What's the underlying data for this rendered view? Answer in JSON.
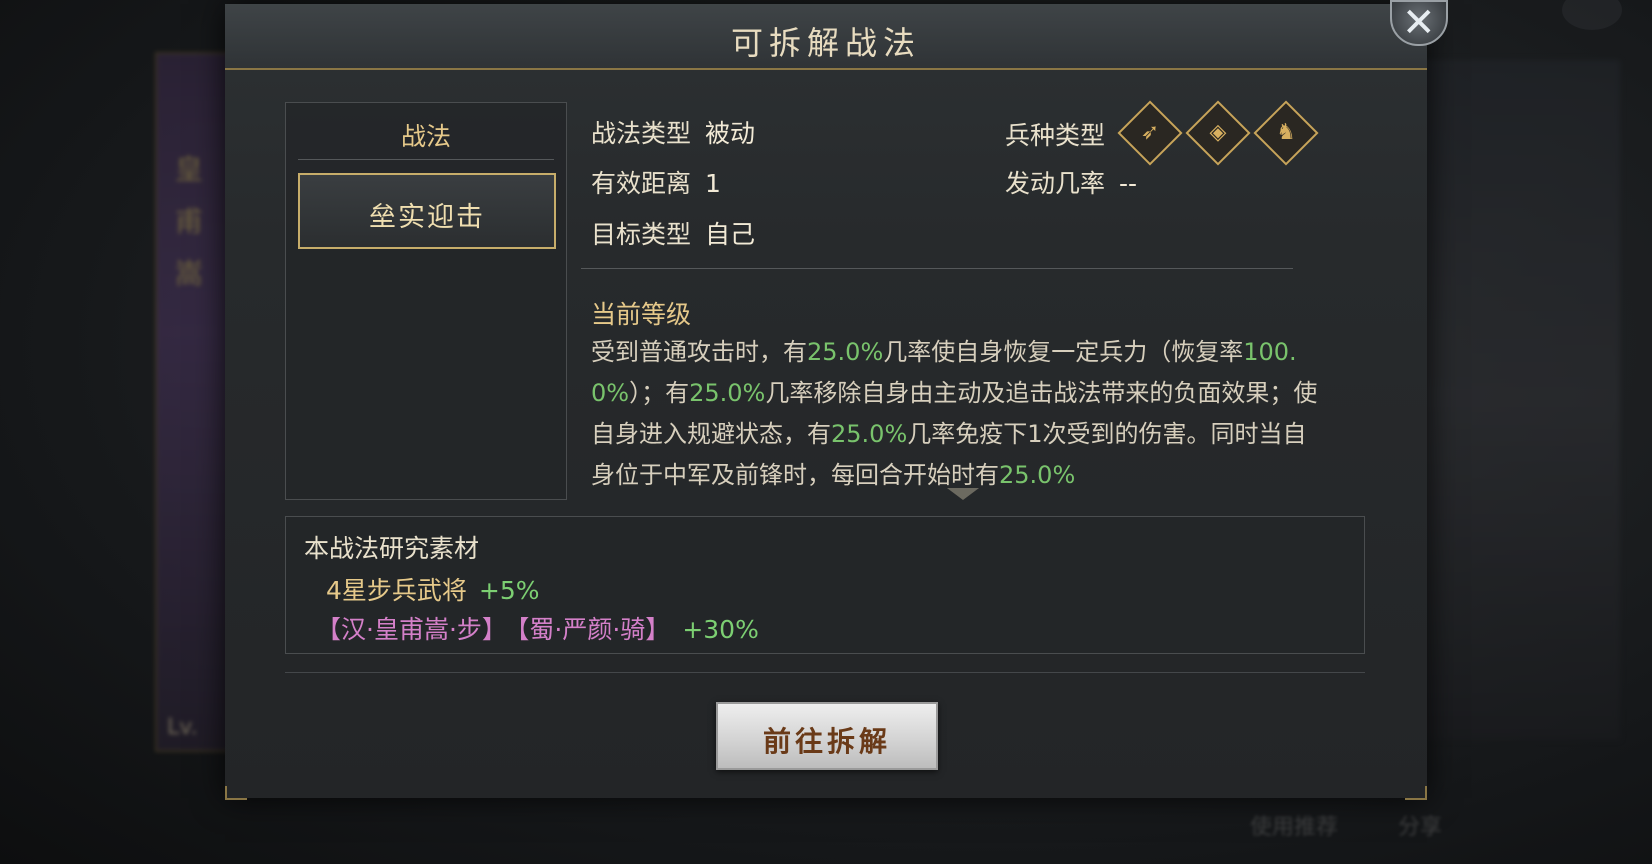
{
  "dialog": {
    "title": "可拆解战法",
    "close_label": "✕"
  },
  "left_panel": {
    "title": "战法",
    "items": [
      {
        "label": "垒实迎击",
        "selected": true
      }
    ]
  },
  "info": {
    "skill_type_label": "战法类型",
    "skill_type_value": "被动",
    "range_label": "有效距离",
    "range_value": "1",
    "target_label": "目标类型",
    "target_value": "自己",
    "troop_type_label": "兵种类型",
    "troop_icons": [
      "bow-icon",
      "shield-icon",
      "horse-icon"
    ],
    "trigger_rate_label": "发动几率",
    "trigger_rate_value": "--"
  },
  "level": {
    "title": "当前等级",
    "desc_parts": [
      {
        "text": "受到普通攻击时，有",
        "hl": false
      },
      {
        "text": "25.0%",
        "hl": true
      },
      {
        "text": "几率使自身恢复一定兵力（恢复率",
        "hl": false
      },
      {
        "text": "100.0%",
        "hl": true
      },
      {
        "text": "）；有",
        "hl": false
      },
      {
        "text": "25.0%",
        "hl": true
      },
      {
        "text": "几率移除自身由主动及追击战法带来的负面效果；使自身进入规避状态，有",
        "hl": false
      },
      {
        "text": "25.0%",
        "hl": true
      },
      {
        "text": "几率免疫下1次受到的伤害。同时当自身位于中军及前锋时，每回合开始时有",
        "hl": false
      },
      {
        "text": "25.0%",
        "hl": true
      }
    ]
  },
  "materials": {
    "title": "本战法研究素材",
    "line1_name": "4星步兵武将",
    "line1_bonus": "+5%",
    "line2_gen1": "【汉·皇甫嵩·步】",
    "line2_gen2": "【蜀·严颜·骑】",
    "line2_bonus": "+30%"
  },
  "action": {
    "go_label": "前往拆解"
  },
  "background": {
    "card_text": "皇甫嵩",
    "card_level": "Lv.",
    "bottom_left": "使用推荐",
    "bottom_right": "分享"
  },
  "colors": {
    "gold": "#e6c98a",
    "highlight_green": "#79c36c",
    "general_pink": "#d480c9",
    "border_gold": "#c7ad6a"
  }
}
